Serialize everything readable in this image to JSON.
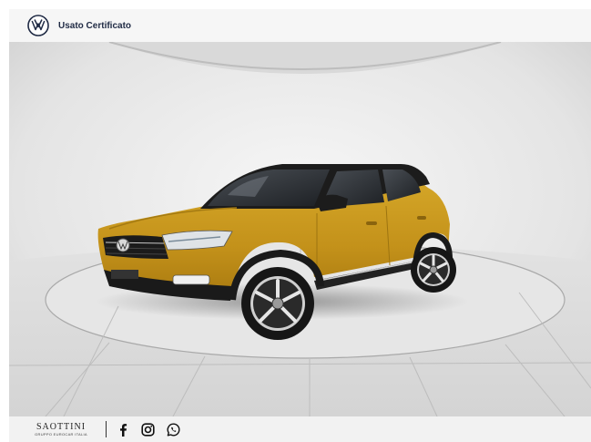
{
  "header": {
    "brand_label": "Usato Certificato",
    "logo_icon": "vw-logo-icon",
    "brand_color": "#1f2a44"
  },
  "vehicle": {
    "body_color": "#c99a1f",
    "roof_color": "#1c1c1c"
  },
  "footer": {
    "dealer_name": "SAOTTINI",
    "dealer_sub": "GRUPPO EUROCAR ITALIA",
    "social_icons": [
      "facebook-icon",
      "instagram-icon",
      "whatsapp-icon"
    ]
  }
}
